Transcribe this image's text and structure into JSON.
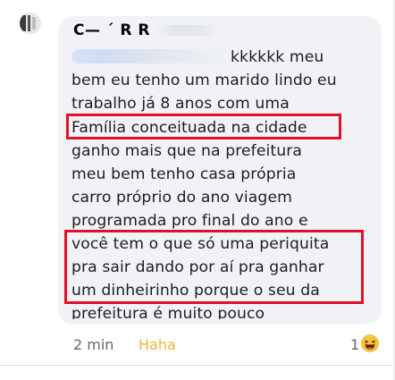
{
  "comment": {
    "author": "C— ´ R  R",
    "lines": [
      "kkkkkk meu",
      "bem eu tenho um marido lindo eu",
      "trabalho já 8 anos com uma",
      "Família conceituada na cidade",
      "ganho mais que na prefeitura",
      "meu bem tenho casa própria",
      "carro próprio do ano viagem",
      "programada pro final do ano e",
      "você tem o que só uma periquita",
      "pra sair dando por aí pra ganhar",
      "um dinheirinho porque o seu da",
      "prefeitura é muito pouco"
    ],
    "time": "2 min",
    "reaction_label": "Haha",
    "reaction_count": "1",
    "reaction_icon": "haha-emoji-icon"
  },
  "colors": {
    "bubble": "#f0f2f5",
    "highlight_border": "#e0102a",
    "haha_text": "#f3b239",
    "meta_text": "#65676b"
  }
}
